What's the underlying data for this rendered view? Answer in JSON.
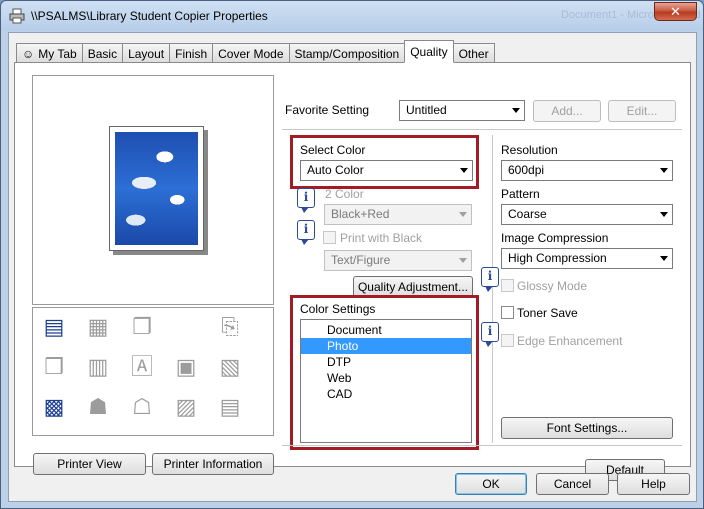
{
  "window": {
    "title": "\\\\PSALMS\\Library Student Copier Properties",
    "ghost_title": "Document1 - Microsoft Word"
  },
  "tabs": [
    "My Tab",
    "Basic",
    "Layout",
    "Finish",
    "Cover Mode",
    "Stamp/Composition",
    "Quality",
    "Other"
  ],
  "active_tab": "Quality",
  "left": {
    "printer_view_label": "Printer View",
    "printer_info_label": "Printer Information"
  },
  "favorite": {
    "label": "Favorite Setting",
    "value": "Untitled",
    "add_label": "Add...",
    "edit_label": "Edit..."
  },
  "color": {
    "select_color_label": "Select Color",
    "select_color_value": "Auto Color",
    "two_color_label": "2 Color",
    "two_color_value": "Black+Red",
    "print_with_black_label": "Print with Black",
    "text_figure_value": "Text/Figure",
    "quality_adjustment_label": "Quality Adjustment..."
  },
  "color_settings": {
    "label": "Color Settings",
    "options": [
      "Document",
      "Photo",
      "DTP",
      "Web",
      "CAD"
    ],
    "selected": "Photo"
  },
  "resolution": {
    "label": "Resolution",
    "value": "600dpi"
  },
  "pattern": {
    "label": "Pattern",
    "value": "Coarse"
  },
  "image_compression": {
    "label": "Image Compression",
    "value": "High Compression"
  },
  "checks": {
    "glossy_label": "Glossy Mode",
    "toner_save_label": "Toner Save",
    "edge_label": "Edge Enhancement"
  },
  "font_settings_label": "Font Settings...",
  "default_label": "Default",
  "buttons": {
    "ok": "OK",
    "cancel": "Cancel",
    "help": "Help"
  },
  "colors": {
    "highlight": "#a31b24",
    "selection": "#3399ff"
  }
}
